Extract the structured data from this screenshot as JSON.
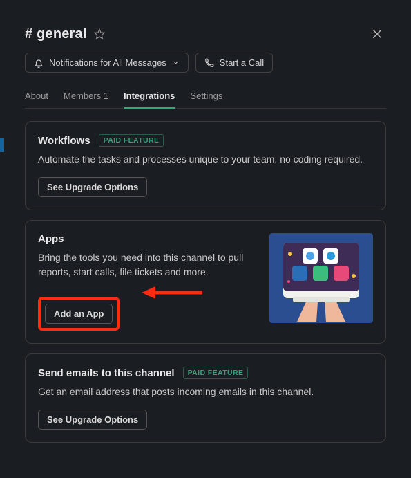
{
  "header": {
    "channel_name": "# general"
  },
  "actions": {
    "notifications_label": "Notifications for All Messages",
    "call_label": "Start a Call"
  },
  "tabs": {
    "about": "About",
    "members": "Members 1",
    "integrations": "Integrations",
    "settings": "Settings"
  },
  "badges": {
    "paid_feature": "PAID FEATURE"
  },
  "cards": {
    "workflows": {
      "title": "Workflows",
      "desc": "Automate the tasks and processes unique to your team, no coding required.",
      "button": "See Upgrade Options"
    },
    "apps": {
      "title": "Apps",
      "desc": "Bring the tools you need into this channel to pull reports, start calls, file tickets and more.",
      "button": "Add an App"
    },
    "emails": {
      "title": "Send emails to this channel",
      "desc": "Get an email address that posts incoming emails in this channel.",
      "button": "See Upgrade Options"
    }
  },
  "colors": {
    "accent_green": "#2bac76",
    "highlight_red": "#ff2a12"
  }
}
